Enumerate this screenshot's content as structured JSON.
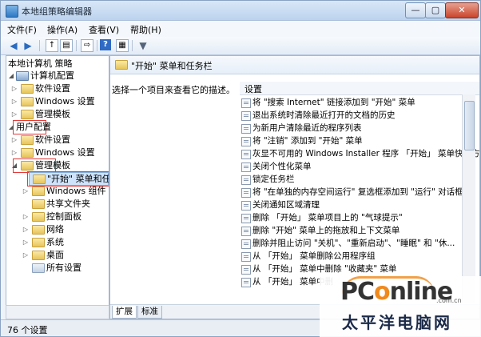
{
  "window": {
    "title": "本地组策略编辑器",
    "controls": {
      "minimize": "—",
      "maximize": "▢",
      "close": "✕"
    }
  },
  "menu": {
    "file": "文件(F)",
    "action": "操作(A)",
    "view": "查看(V)",
    "help": "帮助(H)"
  },
  "toolbar": {
    "icons": [
      "back-icon",
      "forward-icon",
      "up-folder-icon",
      "show-tree-icon",
      "export-icon",
      "help-icon",
      "properties-icon",
      "filter-icon"
    ]
  },
  "tree": {
    "root": "本地计算机 策略",
    "computer_config": "计算机配置",
    "cc_software": "软件设置",
    "cc_windows": "Windows 设置",
    "cc_admin": "管理模板",
    "user_config": "用户配置",
    "uc_software": "软件设置",
    "uc_windows": "Windows 设置",
    "uc_admin": "管理模板",
    "start_menu": "\"开始\" 菜单和任务栏",
    "windows_components": "Windows 组件",
    "shared_folders": "共享文件夹",
    "control_panel": "控制面板",
    "network": "网络",
    "system": "系统",
    "desktop": "桌面",
    "all_settings": "所有设置"
  },
  "right": {
    "header_title": "\"开始\" 菜单和任务栏",
    "description": "选择一个项目来查看它的描述。",
    "column_header": "设置",
    "rows": [
      "将 \"搜索 Internet\" 链接添加到 \"开始\" 菜单",
      "退出系统时清除最近打开的文档的历史",
      "为新用户清除最近的程序列表",
      "将 \"注销\" 添加到 \"开始\" 菜单",
      "灰显不可用的 Windows Installer 程序 「开始」 菜单快捷方...",
      "关闭个性化菜单",
      "锁定任务栏",
      "将 \"在单独的内存空间运行\" 复选框添加到 \"运行\" 对话框",
      "关闭通知区域清理",
      "删除 「开始」 菜单项目上的 \"气球提示\"",
      "删除 \"开始\" 菜单上的拖放和上下文菜单",
      "删除并阻止访问 \"关机\"、\"重新启动\"、\"睡眠\" 和 \"休...",
      "从 「开始」 菜单删除公用程序组",
      "从 「开始」 菜单中删除 \"收藏夹\" 菜单",
      "从 「开始」 菜单中删"
    ],
    "tabs": {
      "extended": "扩展",
      "standard": "标准"
    }
  },
  "status": {
    "text": "76 个设置"
  },
  "watermark": {
    "brand_prefix": "PC",
    "brand_o": "o",
    "brand_suffix": "nline",
    "domain": ".com.cn",
    "chinese": "太平洋电脑网"
  }
}
